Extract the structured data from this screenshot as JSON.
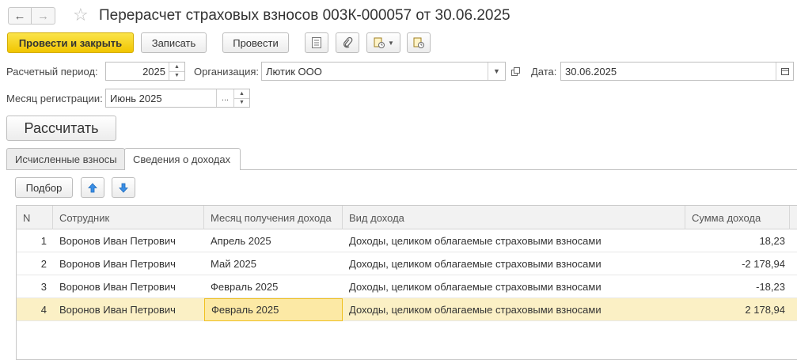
{
  "window": {
    "title": "Перерасчет страховых взносов 003К-000057 от 30.06.2025"
  },
  "toolbar": {
    "post_close": "Провести и закрыть",
    "save": "Записать",
    "post": "Провести"
  },
  "form": {
    "period_label": "Расчетный период:",
    "period_value": "2025",
    "org_label": "Организация:",
    "org_value": "Лютик ООО",
    "date_label": "Дата:",
    "date_value": "30.06.2025",
    "reg_month_label": "Месяц регистрации:",
    "reg_month_value": "Июнь 2025",
    "calc_button": "Рассчитать"
  },
  "tabs": [
    {
      "label": "Исчисленные взносы",
      "active": false
    },
    {
      "label": "Сведения о доходах",
      "active": true
    }
  ],
  "table_toolbar": {
    "pick": "Подбор"
  },
  "table": {
    "columns": [
      "N",
      "Сотрудник",
      "Месяц получения дохода",
      "Вид дохода",
      "Сумма дохода"
    ],
    "rows": [
      {
        "n": "1",
        "employee": "Воронов Иван Петрович",
        "month": "Апрель 2025",
        "kind": "Доходы, целиком облагаемые страховыми взносами",
        "sum": "18,23"
      },
      {
        "n": "2",
        "employee": "Воронов Иван Петрович",
        "month": "Май 2025",
        "kind": "Доходы, целиком облагаемые страховыми взносами",
        "sum": "-2 178,94"
      },
      {
        "n": "3",
        "employee": "Воронов Иван Петрович",
        "month": "Февраль 2025",
        "kind": "Доходы, целиком облагаемые страховыми взносами",
        "sum": "-18,23"
      },
      {
        "n": "4",
        "employee": "Воронов Иван Петрович",
        "month": "Февраль 2025",
        "kind": "Доходы, целиком облагаемые страховыми взносами",
        "sum": "2 178,94"
      }
    ],
    "selected_row": 4,
    "selected_color": "#fbf0c5"
  },
  "colors": {
    "primary_button": "#f1c500"
  }
}
